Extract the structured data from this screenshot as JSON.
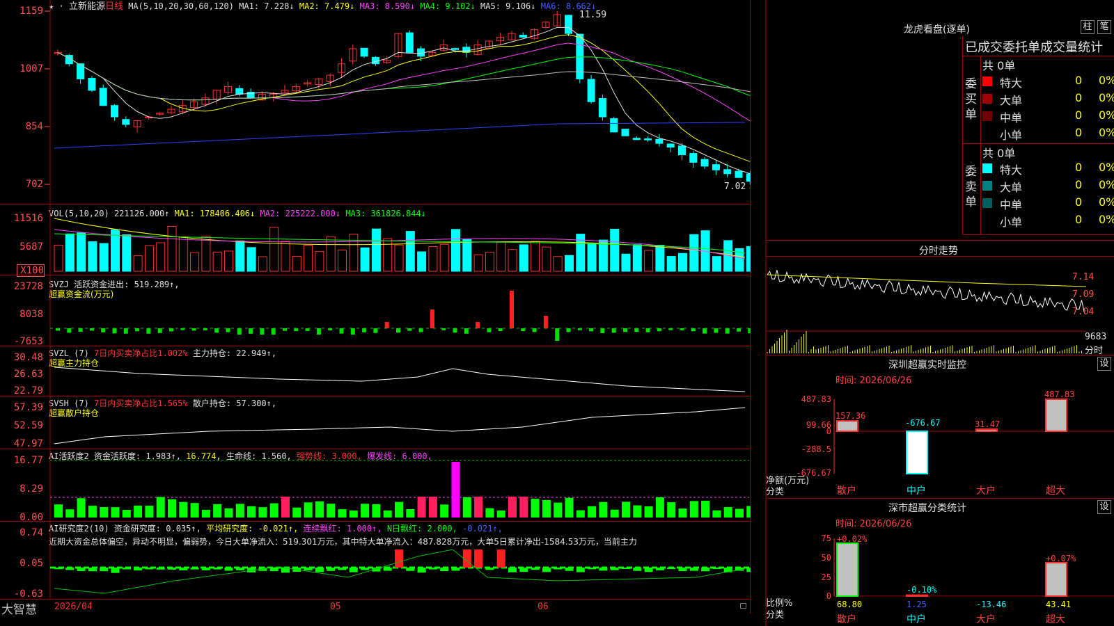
{
  "stock": {
    "name": "立新能源",
    "period": "日线"
  },
  "ma_header": {
    "label": "MA(5,10,20,30,60,120)",
    "items": [
      {
        "text": "MA1: 7.228↓",
        "color": "#e0e0e0"
      },
      {
        "text": "MA2: 7.479↓",
        "color": "#ffff00"
      },
      {
        "text": "MA3: 8.590↓",
        "color": "#ff40ff"
      },
      {
        "text": "MA4: 9.102↓",
        "color": "#00ff00"
      },
      {
        "text": "MA5: 9.106↓",
        "color": "#e0e0e0"
      },
      {
        "text": "MA6: 8.662↓",
        "color": "#4060ff"
      }
    ]
  },
  "price_axis": [
    "1159",
    "1007",
    "854",
    "702"
  ],
  "price_marks": {
    "high": "11.59",
    "low": "7.02"
  },
  "vol_header": {
    "label": "VOL(5,10,20)",
    "value": "221126.000↑",
    "ma1": "MA1: 178406.406↓",
    "ma2": "MA2: 225222.000↓",
    "ma3": "MA3: 361826.844↓"
  },
  "vol_axis": [
    "11516",
    "5687",
    "X100"
  ],
  "svzj": {
    "line1": "SVZJ  活跃资金进出: 519.289↑,",
    "line2": "超赢资金流(万元)",
    "axis": [
      "23728",
      "8038",
      "-7653"
    ]
  },
  "svzl": {
    "line1a": "SVZL (7)",
    "line1b": "7日内买卖净占比1.002%",
    "line1c": "主力持仓: 22.949↑,",
    "line2": "超赢主力持仓",
    "axis": [
      "30.48",
      "26.63",
      "22.79"
    ]
  },
  "svsh": {
    "line1a": "SVSH (7)",
    "line1b": "7日内买卖净占比1.565%",
    "line1c": "散户持仓: 57.300↑,",
    "line2": "超赢散户持仓",
    "axis": [
      "57.39",
      "52.59",
      "47.97"
    ]
  },
  "ai_active": {
    "a": "AI活跃度2 资金活跃度: 1.983↑,",
    "b": "16.774,",
    "c": "生命线: 1.560,",
    "d": "强势线: 3.000,",
    "e": "爆发线: 6.000,",
    "axis": [
      "16.77",
      "8.29",
      "0.00"
    ]
  },
  "ai_research": {
    "a": "AI研究度2(10) 资金研究度: 0.035↑,",
    "b": "平均研究度: -0.021↑,",
    "c": "连续飘红: 1.000↑,",
    "d": "N日飘红: 2.000,",
    "e": "-0.021↑,",
    "text": "近期大资金总体偏空，异动不明显，偏弱势，今日大单净流入：519.301万元，其中特大单净流入：487.828万元，大单5日累计净出-1584.53万元，当前主力",
    "axis": [
      "0.74",
      "0.05",
      "-0.63"
    ]
  },
  "date_axis": [
    "2026/04",
    "05",
    "06"
  ],
  "brand": "大智慧",
  "right_panel": {
    "title": "龙虎看盘(逐单)",
    "btn1": "柱",
    "btn2": "笔",
    "tabs": [
      "已成交",
      "委托单",
      "成交量统计"
    ],
    "buy": {
      "side": "委买单",
      "total": "共 0单",
      "rows": [
        {
          "label": "特大",
          "v": "0",
          "p": "0%",
          "color": "#ff0000"
        },
        {
          "label": "大单",
          "v": "0",
          "p": "0%",
          "color": "#a00000"
        },
        {
          "label": "中单",
          "v": "0",
          "p": "0%",
          "color": "#700000"
        },
        {
          "label": "小单",
          "v": "0",
          "p": "0%",
          "color": ""
        }
      ]
    },
    "sell": {
      "side": "委卖单",
      "total": "共 0单",
      "rows": [
        {
          "label": "特大",
          "v": "0",
          "p": "0%",
          "color": "#00ffff"
        },
        {
          "label": "大单",
          "v": "0",
          "p": "0%",
          "color": "#008080"
        },
        {
          "label": "中单",
          "v": "0",
          "p": "0%",
          "color": "#006060"
        },
        {
          "label": "小单",
          "v": "0",
          "p": "0%",
          "color": ""
        }
      ]
    }
  },
  "intraday": {
    "title": "分时走势",
    "axis": [
      "7.14",
      "7.09",
      "7.04"
    ],
    "vol_axis": [
      "9683",
      "分时"
    ]
  },
  "monitor": {
    "title": "深圳超赢实时监控",
    "btn": "设",
    "date": "时间: 2026/06/26",
    "axis": [
      "487.83",
      "99.66",
      "0",
      "-288.5",
      "-676.67"
    ],
    "ylabel1": "净额(万元)",
    "ylabel2": "分类"
  },
  "classify": {
    "title": "深市超赢分类统计",
    "btn": "设",
    "date": "时间: 2026/06/26",
    "axis": [
      "75",
      "50",
      "25",
      "0"
    ],
    "ylabel1": "比例%",
    "ylabel2": "分类"
  },
  "chart_data": [
    {
      "type": "bar",
      "title": "深圳超赢实时监控",
      "categories": [
        "散户",
        "中户",
        "大户",
        "超大"
      ],
      "values": [
        157.36,
        -676.67,
        31.47,
        487.83
      ],
      "ylim": [
        -676.67,
        487.83
      ],
      "ylabel": "净额(万元)"
    },
    {
      "type": "bar",
      "title": "深市超赢分类统计",
      "categories": [
        "散户",
        "中户",
        "大户",
        "超大"
      ],
      "values": [
        68.8,
        1.25,
        -13.46,
        43.41
      ],
      "changes": [
        "+0.02%",
        "-0.10%",
        "",
        "+0.07%"
      ],
      "ylim": [
        0,
        75
      ],
      "ylabel": "比例%"
    }
  ]
}
